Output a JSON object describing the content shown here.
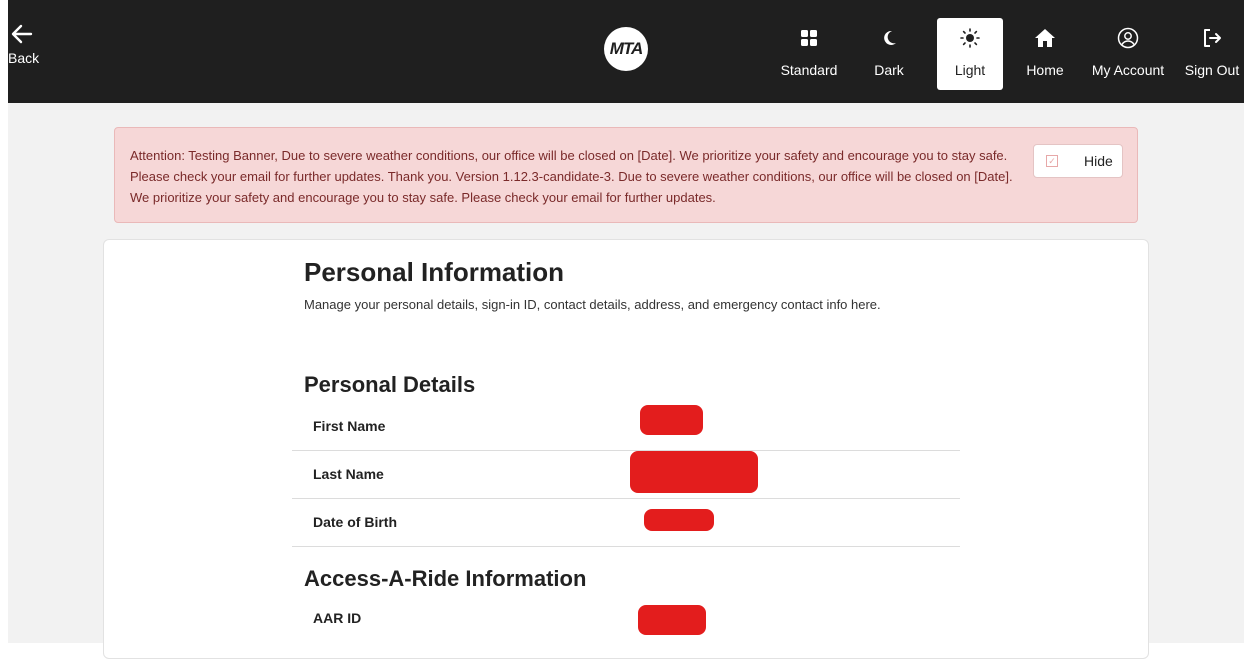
{
  "header": {
    "back_label": "Back",
    "logo_text": "MTA",
    "nav": [
      {
        "label": "Standard",
        "icon": "grid-icon",
        "active": false
      },
      {
        "label": "Dark",
        "icon": "moon-icon",
        "active": false
      },
      {
        "label": "Light",
        "icon": "sun-icon",
        "active": true
      },
      {
        "label": "Home",
        "icon": "home-icon",
        "active": false
      },
      {
        "label": "My Account",
        "icon": "user-circle-icon",
        "active": false
      },
      {
        "label": "Sign Out",
        "icon": "sign-out-icon",
        "active": false
      }
    ]
  },
  "banner": {
    "text": "Attention: Testing Banner, Due to severe weather conditions, our office will be closed on [Date]. We prioritize your safety and encourage you to stay safe. Please check your email for further updates. Thank you. Version 1.12.3-candidate-3. Due to severe weather conditions, our office will be closed on [Date]. We prioritize your safety and encourage you to stay safe. Please check your email for further updates.",
    "hide_label": "Hide"
  },
  "page": {
    "title": "Personal Information",
    "description": "Manage your personal details, sign-in ID, contact details, address, and emergency contact info here."
  },
  "personal_details": {
    "heading": "Personal Details",
    "fields": [
      {
        "label": "First Name",
        "value": ""
      },
      {
        "label": "Last Name",
        "value": ""
      },
      {
        "label": "Date of Birth",
        "value": ""
      }
    ]
  },
  "aar": {
    "heading": "Access-A-Ride Information",
    "fields": [
      {
        "label": "AAR ID",
        "value": ""
      }
    ]
  },
  "colors": {
    "header_bg": "#1f1f1f",
    "banner_bg": "#f6d7d7",
    "redaction": "#e31d1d"
  }
}
